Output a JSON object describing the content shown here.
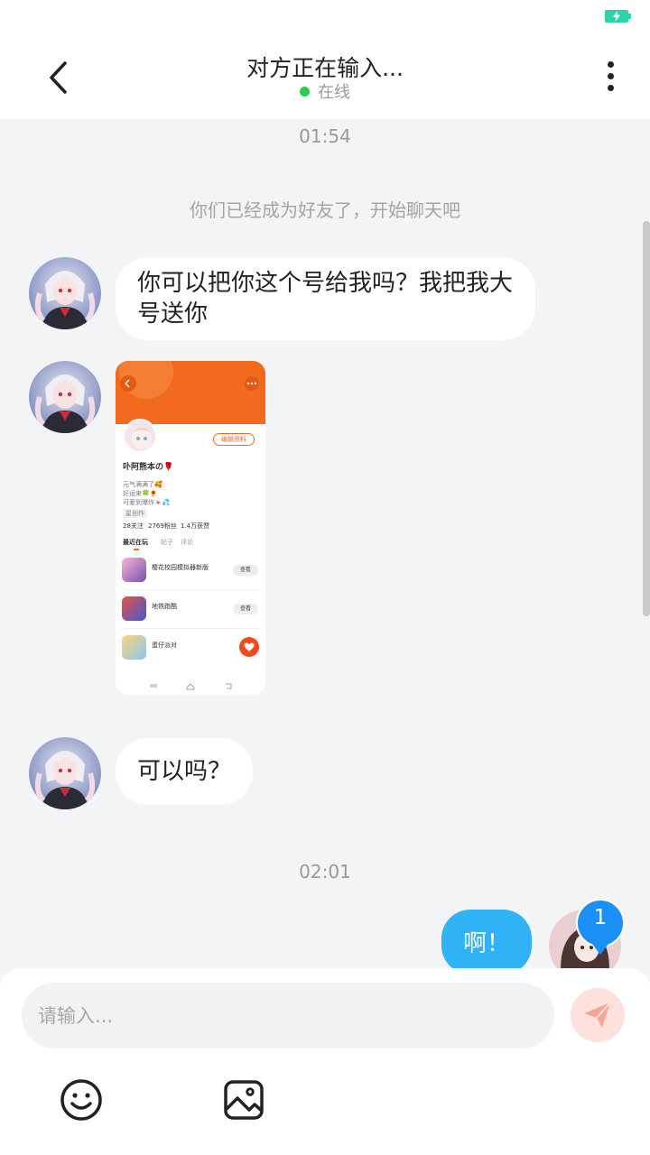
{
  "header": {
    "title": "对方正在输入...",
    "status": "在线",
    "status_color": "#2ecc49"
  },
  "messages": {
    "time_1": "01:54",
    "system_notice": "你们已经成为好友了，开始聊天吧",
    "msg_1": "你可以把你这个号给我吗？我把我大号送你",
    "msg_3": "可以吗？",
    "time_2": "02:01",
    "msg_me": "啊！"
  },
  "screenshot": {
    "edit_label": "编辑资料",
    "nickname": "卟阿熊本の🌹",
    "bio_1": "元气满满了🥰",
    "bio_2": "好运来🍀🌻",
    "bio_3": "可爱到爆炸🍬💦",
    "tag": "星创作",
    "stat_1": "28关注",
    "stat_2": "2769粉丝",
    "stat_3": "1.4万获赞",
    "tab_1": "最近在玩",
    "tab_2": "帖子",
    "tab_3": "评论",
    "app_1": "樱花校园模拟器新版",
    "app_2": "地铁跑酷",
    "app_3": "蛋仔派对",
    "btn_1": "查看",
    "btn_2": "查看"
  },
  "unread_badge": "1",
  "composer": {
    "placeholder": "请输入..."
  },
  "icons": [
    "back-icon",
    "more-icon",
    "battery-icon",
    "send-icon",
    "emoji-icon",
    "image-icon"
  ],
  "colors": {
    "accent_blue": "#2fb2f6",
    "send_button_bg": "#fce1dc",
    "send_icon": "#f8a595",
    "screenshot_orange": "#f26a1e"
  }
}
